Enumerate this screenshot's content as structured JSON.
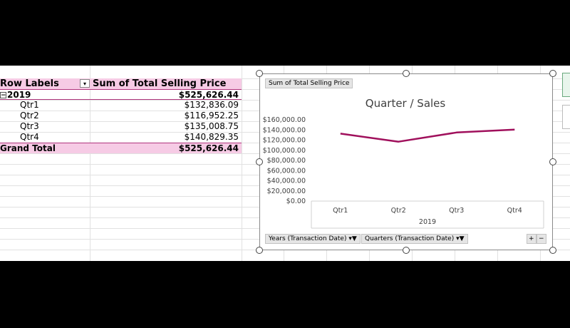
{
  "pivot": {
    "header_label": "Row Labels",
    "header_value": "Sum of Total Selling Price",
    "year_row": {
      "label": "2019",
      "value": "$525,626.44"
    },
    "rows": [
      {
        "label": "Qtr1",
        "value": "$132,836.09"
      },
      {
        "label": "Qtr2",
        "value": "$116,952.25"
      },
      {
        "label": "Qtr3",
        "value": "$135,008.75"
      },
      {
        "label": "Qtr4",
        "value": "$140,829.35"
      }
    ],
    "grand_total": {
      "label": "Grand Total",
      "value": "$525,626.44"
    }
  },
  "chart_panel": {
    "value_field_button": "Sum of Total Selling Price",
    "axis_field_buttons": [
      "Years (Transaction Date)",
      "Quarters (Transaction Date)"
    ],
    "expand_label": "+",
    "collapse_label": "−"
  },
  "chart_data": {
    "type": "line",
    "title": "Quarter / Sales",
    "categories": [
      "Qtr1",
      "Qtr2",
      "Qtr3",
      "Qtr4"
    ],
    "group_label": "2019",
    "values": [
      132836.09,
      116952.25,
      135008.75,
      140829.35
    ],
    "ylim": [
      0,
      160000
    ],
    "yticks": [
      "$0.00",
      "$20,000.00",
      "$40,000.00",
      "$60,000.00",
      "$80,000.00",
      "$100,000.00",
      "$120,000.00",
      "$140,000.00",
      "$160,000.00"
    ],
    "line_color": "#a0105c",
    "grid": false
  },
  "colors": {
    "pivot_header": "#f6cbe5",
    "accent": "#b0357d"
  }
}
